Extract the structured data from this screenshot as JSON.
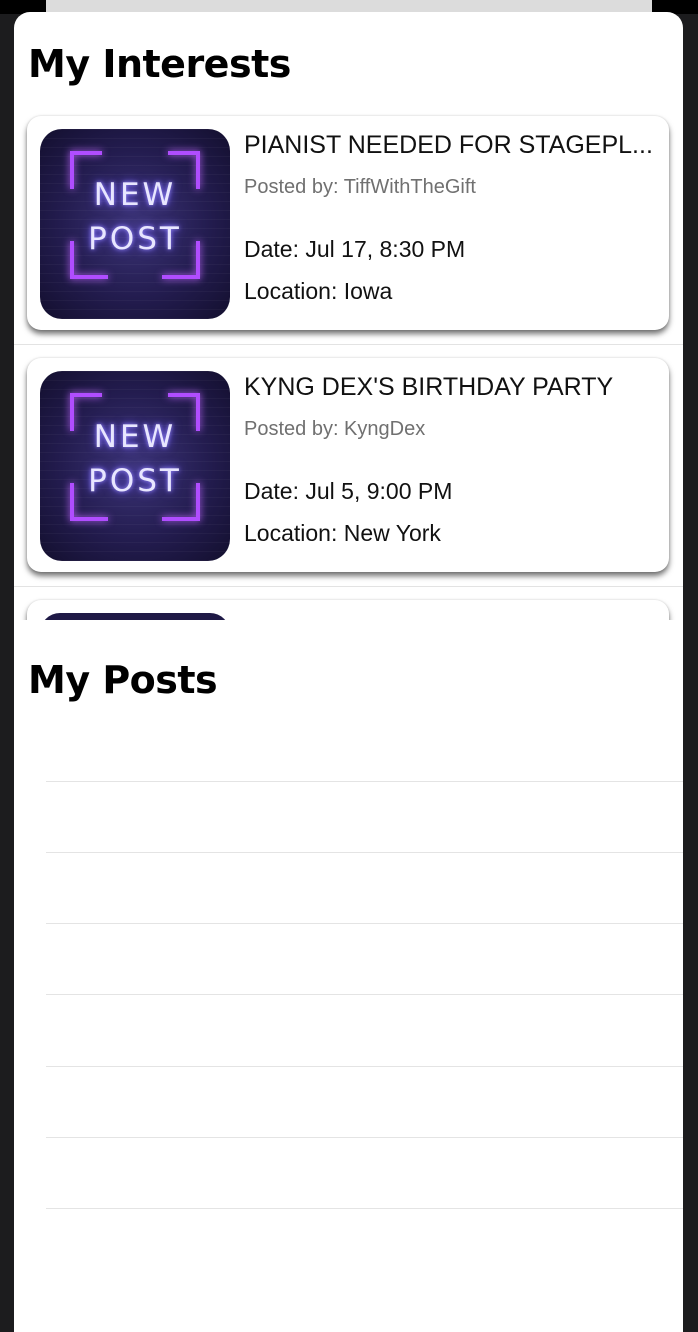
{
  "interests": {
    "title": "My Interests",
    "items": [
      {
        "image_text_line1": "NEW",
        "image_text_line2": "POST",
        "title": "PIANIST NEEDED FOR STAGEPL...",
        "posted_by": "Posted by: TiffWithTheGift",
        "date": "Date: Jul 17, 8:30 PM",
        "location": "Location: Iowa"
      },
      {
        "image_text_line1": "NEW",
        "image_text_line2": "POST",
        "title": "KYNG DEX'S BIRTHDAY PARTY",
        "posted_by": "Posted by: KyngDex",
        "date": "Date: Jul 5, 9:00 PM",
        "location": "Location: New York"
      }
    ]
  },
  "posts": {
    "title": "My Posts"
  },
  "colors": {
    "neon_purple": "#b04dff",
    "card_bg": "#ffffff",
    "page_bg": "#1c1c1e"
  }
}
